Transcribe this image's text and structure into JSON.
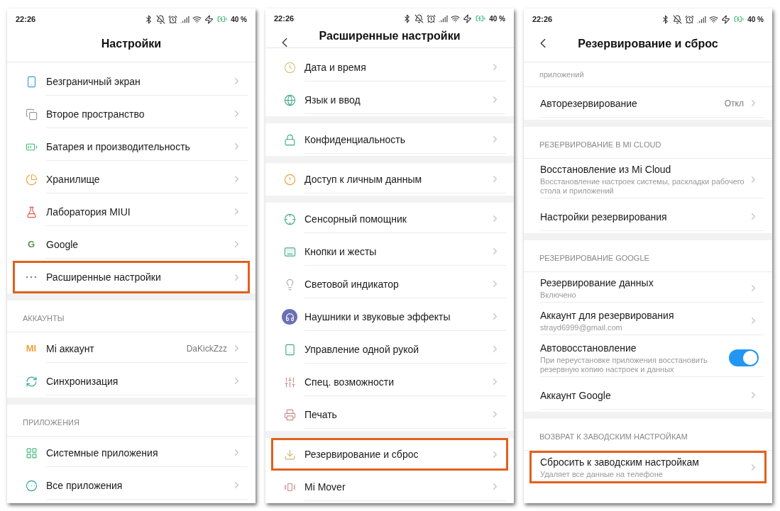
{
  "screens": [
    {
      "status_bar": {
        "time": "22:26",
        "battery": "40 %"
      },
      "title": "Настройки",
      "back": false,
      "groups": [
        {
          "items": [
            {
              "label": "Безграничный экран",
              "highlighted": false
            },
            {
              "label": "Второе пространство",
              "highlighted": false
            },
            {
              "label": "Батарея и производительность",
              "highlighted": false
            },
            {
              "label": "Хранилище",
              "highlighted": false
            },
            {
              "label": "Лаборатория MIUI",
              "highlighted": false
            },
            {
              "label": "Google",
              "icon_text": "G",
              "highlighted": false
            },
            {
              "label": "Расширенные настройки",
              "highlighted": true
            }
          ]
        },
        {
          "header": "АККАУНТЫ",
          "items": [
            {
              "label": "Mi аккаунт",
              "icon_text": "MI",
              "value": "DaKickZzz",
              "highlighted": false
            },
            {
              "label": "Синхронизация",
              "highlighted": false
            }
          ]
        },
        {
          "header": "ПРИЛОЖЕНИЯ",
          "items": [
            {
              "label": "Системные приложения",
              "highlighted": false
            },
            {
              "label": "Все приложения",
              "highlighted": false
            }
          ]
        }
      ]
    },
    {
      "status_bar": {
        "time": "22:26",
        "battery": "40 %"
      },
      "title": "Расширенные настройки",
      "back": true,
      "groups": [
        {
          "items": [
            {
              "label": "Дата и время",
              "highlighted": false
            },
            {
              "label": "Язык и ввод",
              "highlighted": false
            }
          ]
        },
        {
          "items": [
            {
              "label": "Конфиденциальность",
              "highlighted": false
            }
          ]
        },
        {
          "items": [
            {
              "label": "Доступ к личным данным",
              "highlighted": false
            }
          ]
        },
        {
          "items": [
            {
              "label": "Сенсорный помощник",
              "highlighted": false
            },
            {
              "label": "Кнопки и жесты",
              "highlighted": false
            },
            {
              "label": "Световой индикатор",
              "highlighted": false
            },
            {
              "label": "Наушники и звуковые эффекты",
              "highlighted": false
            },
            {
              "label": "Управление одной рукой",
              "highlighted": false
            },
            {
              "label": "Спец. возможности",
              "highlighted": false
            },
            {
              "label": "Печать",
              "highlighted": false
            }
          ]
        },
        {
          "items": [
            {
              "label": "Резервирование и сброс",
              "highlighted": true
            },
            {
              "label": "Mi Mover",
              "highlighted": false
            }
          ]
        }
      ]
    },
    {
      "status_bar": {
        "time": "22:26",
        "battery": "40 %"
      },
      "title": "Резервирование и сброс",
      "back": true,
      "groups": [
        {
          "items": [
            {
              "kind": "fragment",
              "subtitle": "приложений"
            },
            {
              "label": "Авторезервирование",
              "value": "Откл",
              "highlighted": false
            }
          ]
        },
        {
          "header": "РЕЗЕРВИРОВАНИЕ В MI CLOUD",
          "items": [
            {
              "label": "Восстановление из Mi Cloud",
              "subtitle": "Восстановление настроек системы, раскладки рабочего стола и приложений",
              "highlighted": false
            },
            {
              "label": "Настройки резервирования",
              "highlighted": false
            }
          ]
        },
        {
          "header": "РЕЗЕРВИРОВАНИЕ GOOGLE",
          "items": [
            {
              "label": "Резервирование данных",
              "subtitle": "Включено",
              "highlighted": false
            },
            {
              "label": "Аккаунт для резервирования",
              "subtitle": "strayd6999@gmail.com",
              "highlighted": false
            },
            {
              "kind": "toggle",
              "label": "Автовосстановление",
              "subtitle": "При переустановке приложения восстановить резервную копию настроек и данных",
              "on": true
            },
            {
              "label": "Аккаунт Google",
              "highlighted": false
            }
          ]
        },
        {
          "header": "ВОЗВРАТ К ЗАВОДСКИМ НАСТРОЙКАМ",
          "items": [
            {
              "label": "Сбросить к заводским настройкам",
              "subtitle": "Удаляет все данные на телефоне",
              "highlighted": true
            }
          ]
        }
      ]
    }
  ]
}
